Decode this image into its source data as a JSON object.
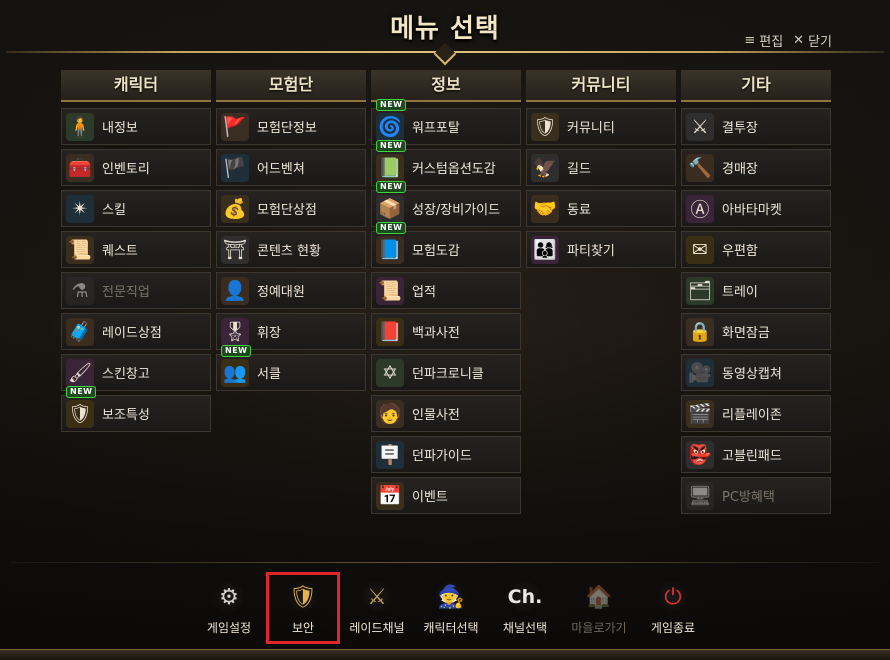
{
  "title": "메뉴 선택",
  "header_tools": {
    "edit_label": "편집",
    "close_label": "닫기",
    "edit_icon": "≡",
    "close_icon": "✕"
  },
  "columns": [
    {
      "title": "캐릭터",
      "items": [
        {
          "label": "내정보",
          "icon": "🧍",
          "new": false,
          "disabled": false
        },
        {
          "label": "인벤토리",
          "icon": "🧰",
          "new": false,
          "disabled": false
        },
        {
          "label": "스킬",
          "icon": "✴",
          "new": false,
          "disabled": false
        },
        {
          "label": "퀘스트",
          "icon": "📜",
          "new": false,
          "disabled": false
        },
        {
          "label": "전문직업",
          "icon": "⚗",
          "new": false,
          "disabled": true
        },
        {
          "label": "레이드상점",
          "icon": "🧳",
          "new": false,
          "disabled": false
        },
        {
          "label": "스킨창고",
          "icon": "🖌",
          "new": false,
          "disabled": false
        },
        {
          "label": "보조특성",
          "icon": "🛡",
          "new": true,
          "disabled": false
        }
      ]
    },
    {
      "title": "모험단",
      "items": [
        {
          "label": "모험단정보",
          "icon": "🚩",
          "new": false,
          "disabled": false
        },
        {
          "label": "어드벤쳐",
          "icon": "🏴",
          "new": false,
          "disabled": false
        },
        {
          "label": "모험단상점",
          "icon": "💰",
          "new": false,
          "disabled": false
        },
        {
          "label": "콘텐츠 현황",
          "icon": "⛩",
          "new": false,
          "disabled": false
        },
        {
          "label": "정예대원",
          "icon": "👤",
          "new": false,
          "disabled": false
        },
        {
          "label": "휘장",
          "icon": "🎖",
          "new": false,
          "disabled": false
        },
        {
          "label": "서클",
          "icon": "👥",
          "new": true,
          "disabled": false
        }
      ]
    },
    {
      "title": "정보",
      "items": [
        {
          "label": "워프포탈",
          "icon": "🌀",
          "new": true,
          "disabled": false
        },
        {
          "label": "커스텀옵션도감",
          "icon": "📗",
          "new": true,
          "disabled": false
        },
        {
          "label": "성장/장비가이드",
          "icon": "📦",
          "new": true,
          "disabled": false
        },
        {
          "label": "모험도감",
          "icon": "📘",
          "new": true,
          "disabled": false
        },
        {
          "label": "업적",
          "icon": "📜",
          "new": false,
          "disabled": false
        },
        {
          "label": "백과사전",
          "icon": "📕",
          "new": false,
          "disabled": false
        },
        {
          "label": "던파크로니클",
          "icon": "✡",
          "new": false,
          "disabled": false
        },
        {
          "label": "인물사전",
          "icon": "🧑",
          "new": false,
          "disabled": false
        },
        {
          "label": "던파가이드",
          "icon": "🪧",
          "new": false,
          "disabled": false
        },
        {
          "label": "이벤트",
          "icon": "📅",
          "new": false,
          "disabled": false
        }
      ]
    },
    {
      "title": "커뮤니티",
      "items": [
        {
          "label": "커뮤니티",
          "icon": "🛡",
          "new": false,
          "disabled": false
        },
        {
          "label": "길드",
          "icon": "🦅",
          "new": false,
          "disabled": false
        },
        {
          "label": "동료",
          "icon": "🤝",
          "new": false,
          "disabled": false
        },
        {
          "label": "파티찾기",
          "icon": "👨‍👩‍👦",
          "new": false,
          "disabled": false
        }
      ]
    },
    {
      "title": "기타",
      "items": [
        {
          "label": "결투장",
          "icon": "⚔",
          "new": false,
          "disabled": false
        },
        {
          "label": "경매장",
          "icon": "🔨",
          "new": false,
          "disabled": false
        },
        {
          "label": "아바타마켓",
          "icon": "Ⓐ",
          "new": false,
          "disabled": false
        },
        {
          "label": "우편함",
          "icon": "✉",
          "new": false,
          "disabled": false
        },
        {
          "label": "트레이",
          "icon": "🗂",
          "new": false,
          "disabled": false
        },
        {
          "label": "화면잠금",
          "icon": "🔒",
          "new": false,
          "disabled": false
        },
        {
          "label": "동영상캡쳐",
          "icon": "🎥",
          "new": false,
          "disabled": false
        },
        {
          "label": "리플레이존",
          "icon": "🎬",
          "new": false,
          "disabled": false
        },
        {
          "label": "고블린패드",
          "icon": "👺",
          "new": false,
          "disabled": false
        },
        {
          "label": "PC방혜택",
          "icon": "🖥",
          "new": false,
          "disabled": true
        }
      ]
    }
  ],
  "bottom_buttons": [
    {
      "label": "게임설정",
      "icon": "⚙",
      "disabled": false,
      "selected": false
    },
    {
      "label": "보안",
      "icon": "🛡",
      "disabled": false,
      "selected": true
    },
    {
      "label": "레이드채널",
      "icon": "⚔",
      "disabled": false,
      "selected": false
    },
    {
      "label": "캐릭터선택",
      "icon": "🧙",
      "disabled": false,
      "selected": false
    },
    {
      "label": "채널선택",
      "icon": "Ch.",
      "disabled": false,
      "selected": false
    },
    {
      "label": "마을로가기",
      "icon": "🏠",
      "disabled": true,
      "selected": false
    },
    {
      "label": "게임종료",
      "icon": "⏻",
      "disabled": false,
      "selected": false
    }
  ],
  "new_badge_text": "NEW",
  "colors": {
    "accent_gold": "#c8a55a",
    "selected_outline": "#e0252b",
    "new_badge": "#3fd23f"
  }
}
